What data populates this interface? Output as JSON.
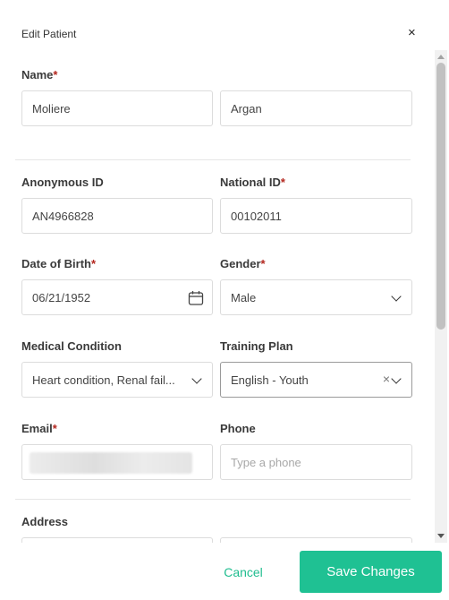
{
  "dialog": {
    "title": "Edit Patient",
    "close_label": "×"
  },
  "form": {
    "name": {
      "label": "Name",
      "required": "*",
      "first": "Moliere",
      "last": "Argan"
    },
    "anonymous_id": {
      "label": "Anonymous ID",
      "value": "AN4966828"
    },
    "national_id": {
      "label": "National ID",
      "required": "*",
      "value": "00102011"
    },
    "dob": {
      "label": "Date of Birth",
      "required": "*",
      "value": "06/21/1952"
    },
    "gender": {
      "label": "Gender",
      "required": "*",
      "value": "Male"
    },
    "medical_condition": {
      "label": "Medical Condition",
      "value": "Heart condition, Renal fail..."
    },
    "training_plan": {
      "label": "Training Plan",
      "value": "English - Youth",
      "clear": "×"
    },
    "email": {
      "label": "Email",
      "required": "*"
    },
    "phone": {
      "label": "Phone",
      "placeholder": "Type a phone"
    },
    "address": {
      "label": "Address"
    }
  },
  "footer": {
    "cancel_label": "Cancel",
    "save_label": "Save Changes"
  },
  "colors": {
    "accent": "#1fc193",
    "required": "#b3261e"
  }
}
